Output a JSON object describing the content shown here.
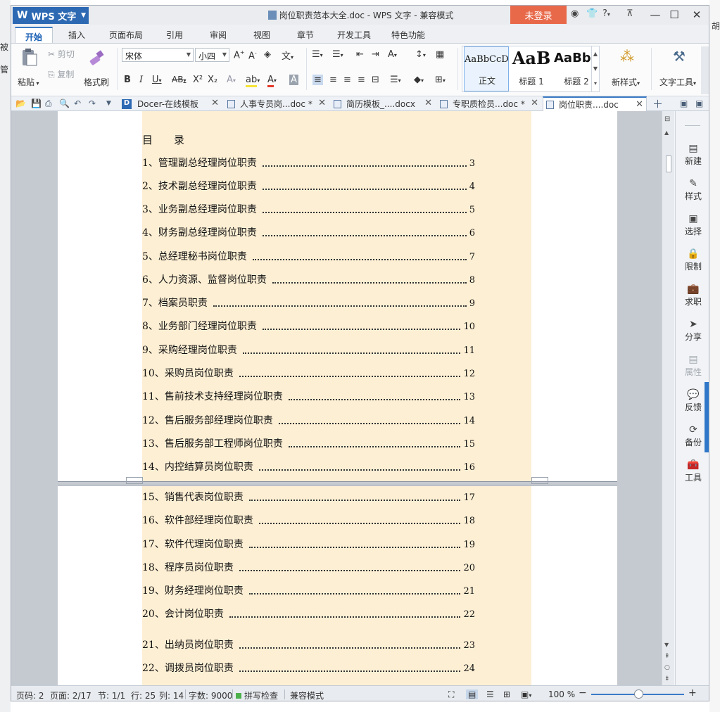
{
  "background_left": [
    "被",
    "管"
  ],
  "background_right": [
    "胡"
  ],
  "titlebar": {
    "app_name": "WPS 文字",
    "app_logo": "W",
    "document_title": "岗位职责范本大全.doc - WPS 文字 - 兼容模式",
    "login_label": "未登录",
    "help_label": "?"
  },
  "ribbon_tabs": [
    "开始",
    "插入",
    "页面布局",
    "引用",
    "审阅",
    "视图",
    "章节",
    "开发工具",
    "特色功能"
  ],
  "ribbon": {
    "paste_label": "粘贴",
    "cut_label": "剪切",
    "copy_label": "复制",
    "format_painter_label": "格式刷",
    "font_name": "宋体",
    "font_size": "小四",
    "bold": "B",
    "italic": "I",
    "underline": "U",
    "strike": "AB",
    "superscript": "X²",
    "subscript": "X₂",
    "styles": [
      {
        "preview": "AaBbCcD",
        "name": "正文"
      },
      {
        "preview": "AaB",
        "name": "标题 1"
      },
      {
        "preview": "AaBb(",
        "name": "标题 2"
      }
    ],
    "new_style_label": "新样式",
    "text_tools_label": "文字工具"
  },
  "doc_tabs": [
    {
      "label": "Docer-在线模板",
      "icon": "docer-icon"
    },
    {
      "label": "人事专员岗...doc *",
      "icon": "doc-file-icon"
    },
    {
      "label": "简历模板_....docx",
      "icon": "doc-file-icon"
    },
    {
      "label": "专职质检员...doc *",
      "icon": "doc-file-icon"
    },
    {
      "label": "岗位职责....doc",
      "icon": "doc-file-icon"
    }
  ],
  "document": {
    "toc_heading": "目　　录",
    "toc_page1": [
      {
        "title": "1、管理副总经理岗位职责",
        "page": "3"
      },
      {
        "title": "2、技术副总经理岗位职责",
        "page": "4"
      },
      {
        "title": "3、业务副总经理岗位职责",
        "page": "5"
      },
      {
        "title": "4、财务副总经理岗位职责",
        "page": "6"
      },
      {
        "title": "5、总经理秘书岗位职责",
        "page": "7"
      },
      {
        "title": "6、人力资源、监督岗位职责",
        "page": "8"
      },
      {
        "title": "7、档案员职责",
        "page": "9"
      },
      {
        "title": "8、业务部门经理岗位职责",
        "page": "10"
      },
      {
        "title": "9、采购经理岗位职责",
        "page": "11"
      },
      {
        "title": "10、采购员岗位职责",
        "page": "12"
      },
      {
        "title": "11、售前技术支持经理岗位职责",
        "page": "13"
      },
      {
        "title": "12、售后服务部经理岗位职责",
        "page": "14"
      },
      {
        "title": "13、售后服务部工程师岗位职责",
        "page": "15"
      },
      {
        "title": "14、内控结算员岗位职责",
        "page": "16"
      }
    ],
    "toc_page2": [
      {
        "title": "15、销售代表岗位职责",
        "page": "17"
      },
      {
        "title": "16、软件部经理岗位职责",
        "page": "18"
      },
      {
        "title": "17、软件代理岗位职责",
        "page": "19"
      },
      {
        "title": "18、程序员岗位职责",
        "page": "20"
      },
      {
        "title": "19、财务经理岗位职责",
        "page": "21"
      },
      {
        "title": "20、会计岗位职责",
        "page": "22"
      },
      {
        "title": "21、出纳员岗位职责",
        "page": "23"
      },
      {
        "title": "22、调拨员岗位职责",
        "page": "24"
      }
    ]
  },
  "side_panel": [
    {
      "label": "新建",
      "icon": "new-doc-icon"
    },
    {
      "label": "样式",
      "icon": "style-icon"
    },
    {
      "label": "选择",
      "icon": "select-icon"
    },
    {
      "label": "限制",
      "icon": "restrict-icon"
    },
    {
      "label": "求职",
      "icon": "briefcase-icon"
    },
    {
      "label": "分享",
      "icon": "share-icon"
    },
    {
      "label": "属性",
      "icon": "properties-icon"
    },
    {
      "label": "反馈",
      "icon": "feedback-icon"
    },
    {
      "label": "备份",
      "icon": "backup-icon"
    },
    {
      "label": "工具",
      "icon": "toolbox-icon"
    }
  ],
  "status_bar": {
    "page_num": "页码: 2",
    "pages": "页面: 2/17",
    "section": "节: 1/1",
    "row": "行: 25",
    "col": "列: 14",
    "word_count": "字数: 9000",
    "spell_check": "拼写检查",
    "compat_mode": "兼容模式",
    "zoom": "100 %"
  },
  "colors": {
    "accent": "#2d69b3",
    "login": "#e8694a",
    "highlight": "#fdefd4"
  }
}
